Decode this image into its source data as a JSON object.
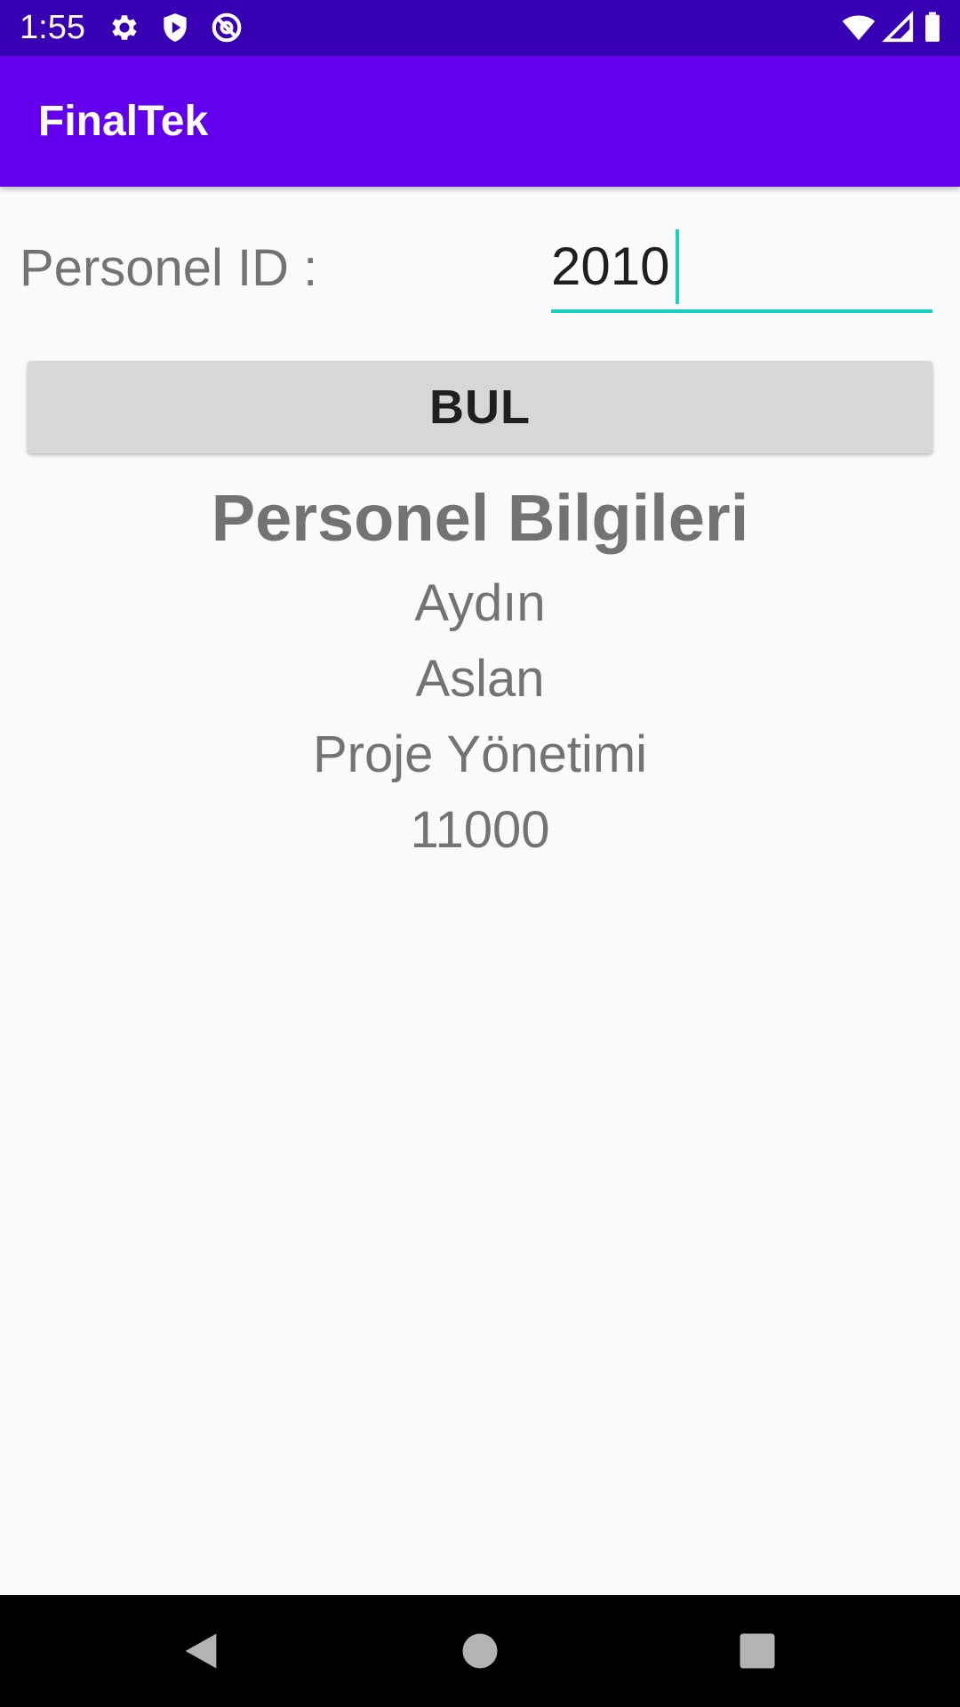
{
  "status_bar": {
    "time": "1:55",
    "icons": [
      "gear-icon",
      "shield-play-icon",
      "no-sync-icon",
      "wifi-icon",
      "signal-icon",
      "battery-icon"
    ],
    "background": "#3700b3"
  },
  "app_bar": {
    "title": "FinalTek",
    "background": "#6200ee"
  },
  "form": {
    "id_label": "Personel ID :",
    "id_value": "2010",
    "accent": "#17d2c0",
    "find_button_label": "BUL"
  },
  "result": {
    "title": "Personel Bilgileri",
    "first_name": "Aydın",
    "last_name": "Aslan",
    "department": "Proje Yönetimi",
    "salary": "11000"
  },
  "nav_bar": {
    "buttons": [
      "back-icon",
      "home-icon",
      "recents-icon"
    ]
  }
}
